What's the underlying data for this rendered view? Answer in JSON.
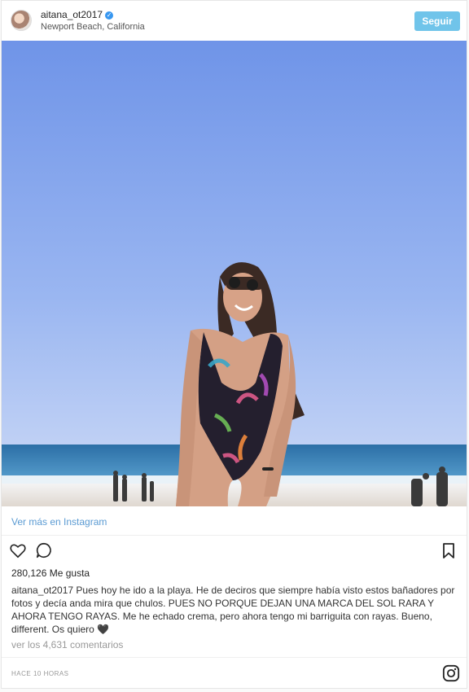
{
  "post": {
    "username": "aitana_ot2017",
    "location": "Newport Beach, California",
    "follow_label": "Seguir",
    "view_more": "Ver más en Instagram",
    "likes": "280,126 Me gusta",
    "caption_user": "aitana_ot2017",
    "caption_text": " Pues hoy he ido a la playa. He de deciros que siempre había visto estos bañadores por fotos y decía anda mira que chulos. PUES NO PORQUE DEJAN UNA MARCA DEL SOL RARA Y AHORA TENGO RAYAS. Me he echado crema, pero ahora tengo mi barriguita con rayas. Bueno, different. Os quiero 🖤",
    "comments_link": "ver los 4,631 comentarios",
    "time": "HACE 10 HORAS"
  },
  "colors": {
    "accent": "#70c4ea",
    "link": "#5b9bd3",
    "verified": "#3897f0"
  },
  "icons": [
    "verified-badge-icon",
    "heart-icon",
    "comment-icon",
    "bookmark-icon",
    "instagram-logo-icon"
  ]
}
